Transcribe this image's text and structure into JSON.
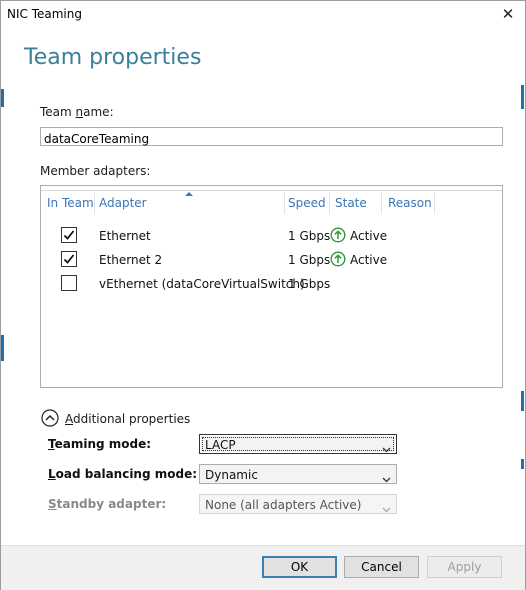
{
  "window": {
    "title": "NIC Teaming",
    "close_glyph": "✕"
  },
  "page_title": "Team properties",
  "team_name": {
    "label": "Team name:",
    "value": "dataCoreTeaming"
  },
  "member_adapters": {
    "label": "Member adapters:",
    "columns": {
      "in_team": "In Team",
      "adapter": "Adapter",
      "speed": "Speed",
      "state": "State",
      "reason": "Reason"
    },
    "sorted_column": "adapter",
    "rows": [
      {
        "checked": true,
        "adapter": "Ethernet",
        "speed": "1 Gbps",
        "state": "Active",
        "state_icon": "arrow-up-circle-icon"
      },
      {
        "checked": true,
        "adapter": "Ethernet 2",
        "speed": "1 Gbps",
        "state": "Active",
        "state_icon": "arrow-up-circle-icon"
      },
      {
        "checked": false,
        "adapter": "vEthernet (dataCoreVirtualSwitch)",
        "speed": "1 Gbps",
        "state": "",
        "state_icon": ""
      }
    ]
  },
  "additional_properties": {
    "toggle_label": "Additional properties",
    "expanded": true,
    "teaming_mode": {
      "label": "Teaming mode:",
      "value": "LACP"
    },
    "load_balancing_mode": {
      "label": "Load balancing mode:",
      "value": "Dynamic"
    },
    "standby_adapter": {
      "label": "Standby adapter:",
      "value": "None (all adapters Active)"
    }
  },
  "buttons": {
    "ok": "OK",
    "cancel": "Cancel",
    "apply": "Apply"
  },
  "colors": {
    "accent": "#3a75b8",
    "title": "#3b7f9a",
    "active_green": "#2e9b3a"
  }
}
